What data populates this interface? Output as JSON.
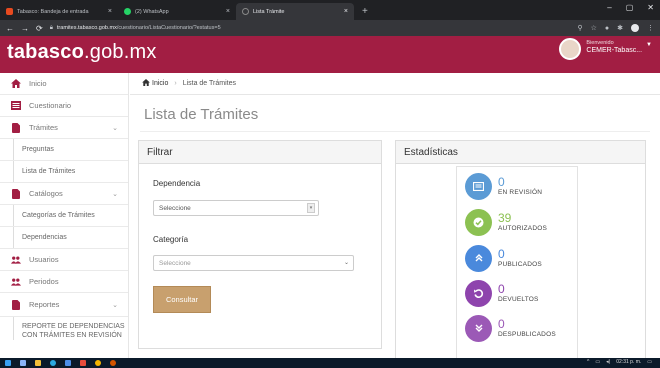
{
  "browser": {
    "tabs": [
      {
        "title": "Tabasco: Bandeja de entrada",
        "close": "×",
        "favicon_color": "#e84a1f"
      },
      {
        "title": "(2) WhatsApp",
        "close": "×",
        "favicon_color": "#25d366"
      },
      {
        "title": "Lista Trámite",
        "close": "×",
        "favicon_color": "#888888"
      }
    ],
    "new_tab": "+",
    "window_controls": {
      "minimize": "–",
      "maximize": "▢",
      "close": "✕"
    },
    "url_host": "tramites.tabasco.gob.mx",
    "url_path": "/cuestionario/ListaCuestionario/?estatus=5"
  },
  "header": {
    "logo_bold": "tabasco",
    "logo_rest": ".gob.mx",
    "user_welcome": "Bienvenido",
    "user_name": "CEMER-Tabasc...",
    "brand_color": "#a21e43"
  },
  "sidebar": {
    "items": [
      {
        "label": "Inicio",
        "icon": "home-icon"
      },
      {
        "label": "Cuestionario",
        "icon": "list-icon"
      },
      {
        "label": "Trámites",
        "icon": "document-icon",
        "chevron": "⌄"
      },
      {
        "label": "Preguntas"
      },
      {
        "label": "Lista de Trámites"
      },
      {
        "label": "Catálogos",
        "icon": "document-icon",
        "chevron": "⌄"
      },
      {
        "label": "Categorías de Trámites"
      },
      {
        "label": "Dependencias"
      },
      {
        "label": "Usuarios",
        "icon": "users-icon"
      },
      {
        "label": "Periodos",
        "icon": "users-icon"
      },
      {
        "label": "Reportes",
        "icon": "document-icon",
        "chevron": "⌄"
      },
      {
        "label": "REPORTE DE DEPENDENCIAS CON TRÁMITES EN REVISIÓN"
      }
    ]
  },
  "breadcrumb": {
    "home": "Inicio",
    "separator": "›",
    "current": "Lista de Trámites"
  },
  "page_title": "Lista de Trámites",
  "filter": {
    "heading": "Filtrar",
    "dependencia_label": "Dependencia",
    "dependencia_value": "Seleccione",
    "categoria_label": "Categoría",
    "categoria_value": "Seleccione",
    "button": "Consultar"
  },
  "stats": {
    "heading": "Estadísticas",
    "items": [
      {
        "value": "0",
        "label": "EN REVISIÓN",
        "color": "#5b9bd5",
        "icon": "inbox-icon"
      },
      {
        "value": "39",
        "label": "AUTORIZADOS",
        "color": "#8cc152",
        "icon": "check-icon"
      },
      {
        "value": "0",
        "label": "PUBLICADOS",
        "color": "#4a89dc",
        "icon": "double-chevron-up-icon"
      },
      {
        "value": "0",
        "label": "DEVUELTOS",
        "color": "#8e44ad",
        "icon": "undo-icon"
      },
      {
        "value": "0",
        "label": "DESPUBLICADOS",
        "color": "#9b59b6",
        "icon": "double-chevron-down-icon"
      }
    ]
  },
  "taskbar": {
    "time": "02:31 p. m."
  }
}
